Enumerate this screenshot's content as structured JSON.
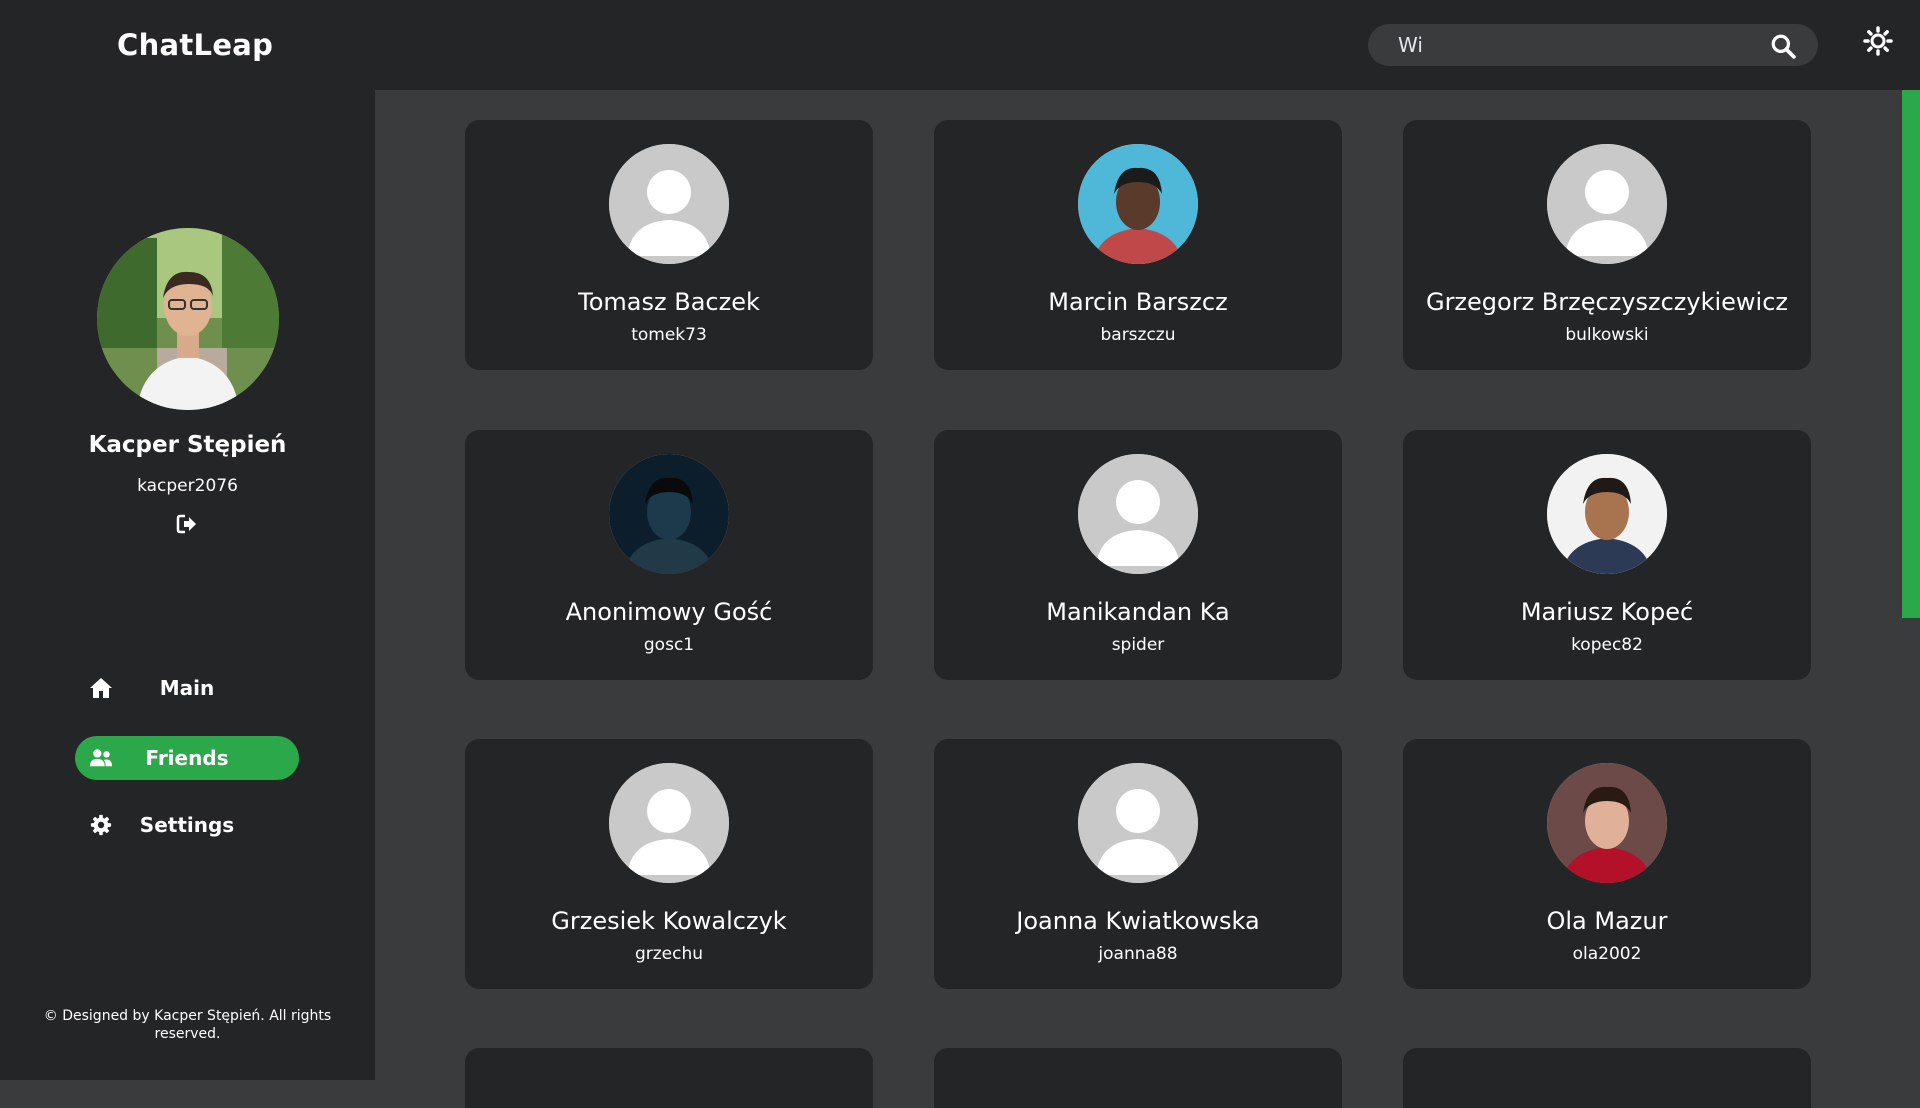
{
  "app": {
    "title": "ChatLeap"
  },
  "search": {
    "value": "Wi",
    "icon": "search-icon"
  },
  "theme_toggle": {
    "icon": "sun-icon"
  },
  "profile": {
    "name": "Kacper Stępień",
    "username": "kacper2076"
  },
  "nav": [
    {
      "label": "Main",
      "icon": "home-icon",
      "active": false
    },
    {
      "label": "Friends",
      "icon": "users-icon",
      "active": true
    },
    {
      "label": "Settings",
      "icon": "gear-icon",
      "active": false
    }
  ],
  "footer": {
    "text": "© Designed by Kacper Stępień. All rights reserved."
  },
  "colors": {
    "accent": "#2aa84a",
    "panel": "#242526",
    "background": "#3a3b3d"
  },
  "users": [
    {
      "name": "Tomasz Baczek",
      "username": "tomek73",
      "avatar": "default"
    },
    {
      "name": "Marcin Barszcz",
      "username": "barszczu",
      "avatar": "photo"
    },
    {
      "name": "Grzegorz Brzęczyszczykiewicz",
      "username": "bulkowski",
      "avatar": "default"
    },
    {
      "name": "Anonimowy Gość",
      "username": "gosc1",
      "avatar": "photo"
    },
    {
      "name": "Manikandan Ka",
      "username": "spider",
      "avatar": "default"
    },
    {
      "name": "Mariusz Kopeć",
      "username": "kopec82",
      "avatar": "photo"
    },
    {
      "name": "Grzesiek Kowalczyk",
      "username": "grzechu",
      "avatar": "default"
    },
    {
      "name": "Joanna Kwiatkowska",
      "username": "joanna88",
      "avatar": "default"
    },
    {
      "name": "Ola Mazur",
      "username": "ola2002",
      "avatar": "photo"
    }
  ]
}
